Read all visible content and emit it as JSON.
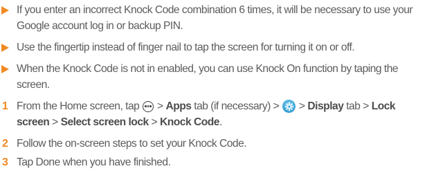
{
  "notes": [
    {
      "line1": "If you enter an incorrect Knock Code combination 6 times, it will be necessary to use your",
      "line2": "Google account log in or backup PIN."
    },
    {
      "line1": "Use the fingertip instead of finger nail to tap the screen for turning it on or off."
    },
    {
      "line1": "When the Knock Code is not in enabled, you can use Knock On function by taping the",
      "line2": "screen."
    }
  ],
  "steps": [
    {
      "number": "1",
      "parts": {
        "p1": "From the Home screen, tap",
        "sep1": " > ",
        "apps": "Apps",
        "p2": " tab (if necessary) > ",
        "sep2": " > ",
        "display": "Display",
        "p3": " tab > ",
        "lock": "Lock",
        "screen": "screen",
        "sep3": " > ",
        "select": "Select screen lock",
        "sep4": " > ",
        "knock": "Knock Code",
        "end": "."
      },
      "icons": [
        "apps-icon",
        "gear-icon"
      ]
    },
    {
      "number": "2",
      "text": "Follow the on-screen steps to set your Knock Code."
    },
    {
      "number": "3",
      "text": "Tap Done when you have finished."
    }
  ],
  "colors": {
    "accent": "#f08a24",
    "text": "#5b5b5b"
  }
}
